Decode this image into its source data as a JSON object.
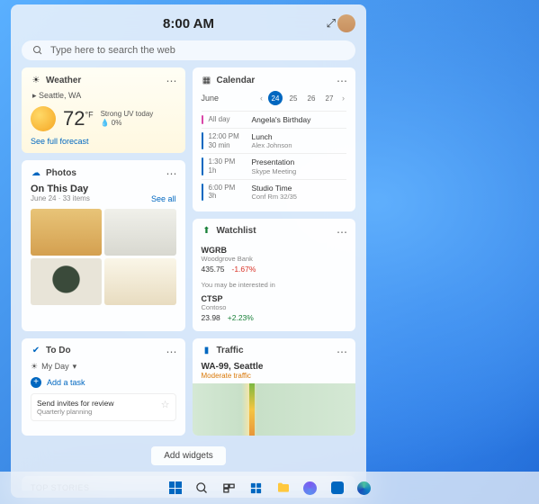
{
  "header": {
    "time": "8:00 AM"
  },
  "search": {
    "placeholder": "Type here to search the web"
  },
  "weather": {
    "title": "Weather",
    "location": "Seattle, WA",
    "temp": "72",
    "unit": "°F",
    "condition": "Strong UV today",
    "precip": "0%",
    "link": "See full forecast"
  },
  "calendar": {
    "title": "Calendar",
    "month": "June",
    "days": [
      "24",
      "25",
      "26",
      "27"
    ],
    "selected": "24",
    "events": [
      {
        "time": "All day",
        "dur": "",
        "name": "Angela's Birthday",
        "sub": "",
        "color": "pink"
      },
      {
        "time": "12:00 PM",
        "dur": "30 min",
        "name": "Lunch",
        "sub": "Alex Johnson",
        "color": "blue"
      },
      {
        "time": "1:30 PM",
        "dur": "1h",
        "name": "Presentation",
        "sub": "Skype Meeting",
        "color": "blue"
      },
      {
        "time": "6:00 PM",
        "dur": "3h",
        "name": "Studio Time",
        "sub": "Conf Rm 32/35",
        "color": "blue"
      }
    ]
  },
  "photos": {
    "title": "Photos",
    "heading": "On This Day",
    "sub": "June 24 · 33 items",
    "link": "See all"
  },
  "watchlist": {
    "title": "Watchlist",
    "rows": [
      {
        "sym": "WGRB",
        "co": "Woodgrove Bank",
        "price": "435.75",
        "chg": "-1.67%",
        "dir": "neg"
      },
      {
        "sym": "CTSP",
        "co": "Contoso",
        "price": "23.98",
        "chg": "+2.23%",
        "dir": "pos"
      }
    ],
    "note": "You may be interested in"
  },
  "todo": {
    "title": "To Do",
    "list": "My Day",
    "add": "Add a task",
    "task": {
      "name": "Send invites for review",
      "sub": "Quarterly planning"
    }
  },
  "traffic": {
    "title": "Traffic",
    "route": "WA-99, Seattle",
    "status": "Moderate traffic"
  },
  "addWidgets": "Add widgets",
  "topStories": "TOP STORIES"
}
